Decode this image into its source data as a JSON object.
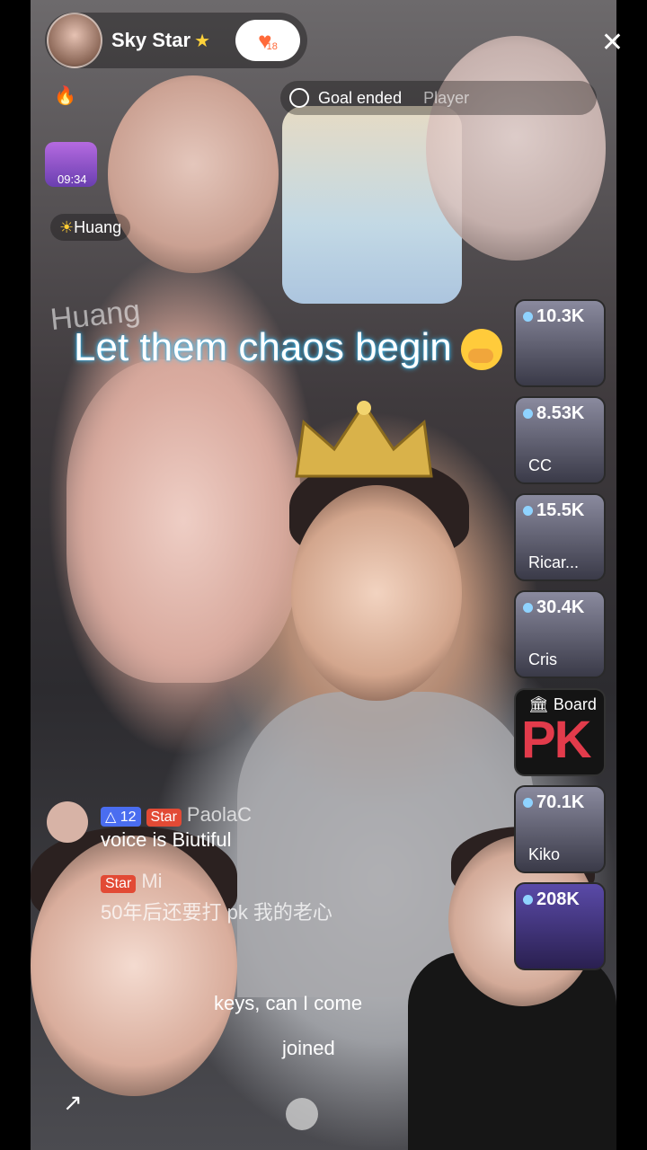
{
  "header": {
    "host_name": "Sky Star",
    "host_star": "★",
    "follow_count": "18",
    "close_label": "✕"
  },
  "goal": {
    "label": "Goal ended",
    "tail": "Player"
  },
  "left_badges": {
    "timer": "09:34",
    "pill_name": "Huang",
    "overlay_name": "Huang"
  },
  "headline": "Let them chaos begin",
  "pk_column": [
    {
      "score": "10.3K",
      "name": ""
    },
    {
      "score": "8.53K",
      "name": "CC"
    },
    {
      "score": "15.5K",
      "name": "Ricar..."
    },
    {
      "score": "30.4K",
      "name": "Cris"
    },
    {
      "score": "70.1K",
      "name": "Kiko"
    },
    {
      "score": "208K",
      "name": ""
    }
  ],
  "board": {
    "title": "Board",
    "pk": "PK"
  },
  "chat": [
    {
      "level": "12",
      "tag": "Star",
      "user": "PaolaC",
      "text": "voice is Biutiful"
    },
    {
      "tag": "Star",
      "user": "Mi",
      "text": "50年后还要打 pk 我的老心"
    },
    {
      "text": "keys, can I come"
    },
    {
      "text": "joined"
    }
  ]
}
